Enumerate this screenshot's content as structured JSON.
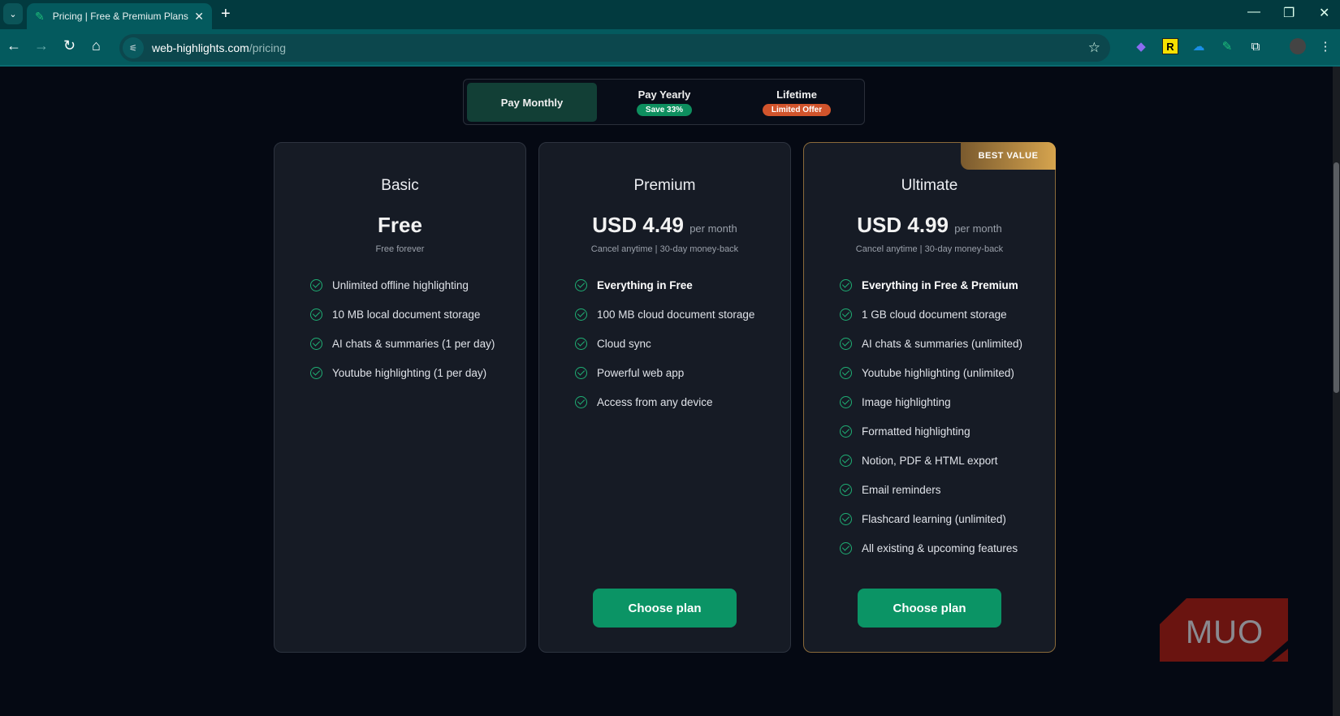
{
  "browser": {
    "tab_title": "Pricing | Free & Premium Plans",
    "url_domain": "web-highlights.com",
    "url_path": "/pricing",
    "extensions": [
      "obsidian-icon",
      "readwise-icon",
      "onedrive-icon",
      "web-highlights-icon",
      "extensions-icon"
    ]
  },
  "billing_toggle": {
    "options": [
      {
        "label": "Pay Monthly",
        "badge": null,
        "active": true
      },
      {
        "label": "Pay Yearly",
        "badge": "Save 33%",
        "badge_color": "#0e8f5f"
      },
      {
        "label": "Lifetime",
        "badge": "Limited Offer",
        "badge_color": "#d1542c"
      }
    ]
  },
  "plans": [
    {
      "name": "Basic",
      "price": "Free",
      "per": "",
      "subtitle": "Free forever",
      "features": [
        "Unlimited offline highlighting",
        "10 MB local document storage",
        "AI chats & summaries (1 per day)",
        "Youtube highlighting (1 per day)"
      ]
    },
    {
      "name": "Premium",
      "price": "USD 4.49",
      "per": "per month",
      "subtitle": "Cancel anytime | 30-day money-back",
      "features": [
        "Everything in Free",
        "100 MB cloud document storage",
        "Cloud sync",
        "Powerful web app",
        "Access from any device"
      ],
      "button": "Choose plan"
    },
    {
      "name": "Ultimate",
      "price": "USD 4.99",
      "per": "per month",
      "subtitle": "Cancel anytime | 30-day money-back",
      "ribbon": "BEST VALUE",
      "features": [
        "Everything in Free & Premium",
        "1 GB cloud document storage",
        "AI chats & summaries (unlimited)",
        "Youtube highlighting (unlimited)",
        "Image highlighting",
        "Formatted highlighting",
        "Notion, PDF & HTML export",
        "Email reminders",
        "Flashcard learning (unlimited)",
        "All existing & upcoming features"
      ],
      "button": "Choose plan"
    }
  ],
  "watermark": "MUO",
  "colors": {
    "accent": "#0b9465",
    "gold": "#d6a44e",
    "background": "#050913"
  }
}
